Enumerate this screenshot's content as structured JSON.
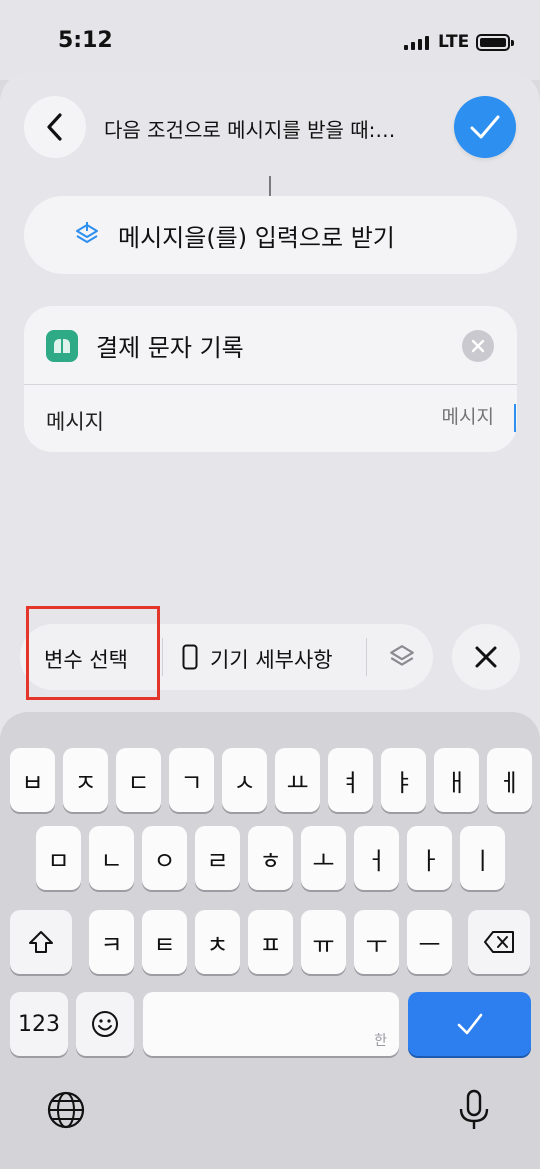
{
  "status_bar": {
    "time": "5:12",
    "network": "LTE"
  },
  "header": {
    "title": "다음 조건으로 메시지를 받을 때:…"
  },
  "trigger_card": {
    "label": "메시지을(를) 입력으로 받기",
    "icon": "shortcut-layers-icon"
  },
  "action_card": {
    "title": "결제 문자 기록",
    "app_icon": "app-icon",
    "field_label": "메시지",
    "field_placeholder": "메시지"
  },
  "variable_bar": {
    "items": [
      {
        "label": "변수 선택"
      },
      {
        "label": "기기 세부사항",
        "icon": "phone-icon"
      },
      {
        "label": "",
        "icon": "shortcut-layers-icon"
      }
    ]
  },
  "keyboard": {
    "row1": [
      "ㅂ",
      "ㅈ",
      "ㄷ",
      "ㄱ",
      "ㅅ",
      "ㅛ",
      "ㅕ",
      "ㅑ",
      "ㅐ",
      "ㅔ"
    ],
    "row2": [
      "ㅁ",
      "ㄴ",
      "ㅇ",
      "ㄹ",
      "ㅎ",
      "ㅗ",
      "ㅓ",
      "ㅏ",
      "ㅣ"
    ],
    "row3": [
      "ㅋ",
      "ㅌ",
      "ㅊ",
      "ㅍ",
      "ㅠ",
      "ㅜ",
      "ㅡ"
    ],
    "numbers_label": "123",
    "space_hint": "한"
  },
  "colors": {
    "accent": "#2d8ff0",
    "highlight": "#e4352b",
    "app_icon": "#2eaa86"
  }
}
